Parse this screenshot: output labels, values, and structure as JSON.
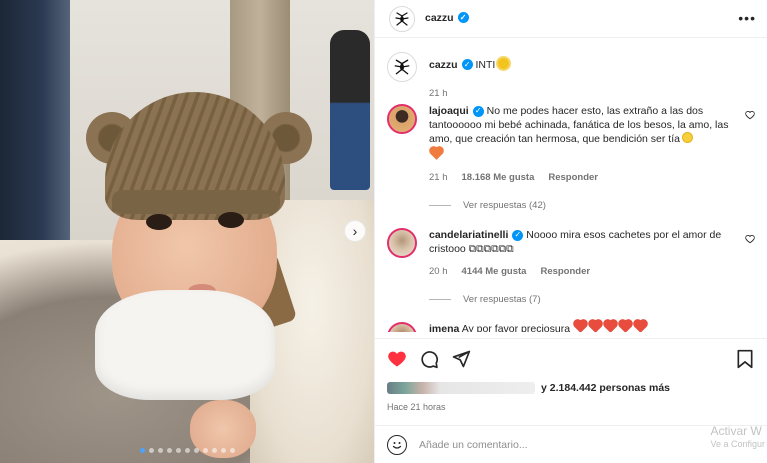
{
  "post": {
    "username": "cazzu",
    "verified_mark": "✓",
    "more_label": "•••",
    "caption_text": "INTI",
    "caption_time": "21 h",
    "carousel_next_label": "›",
    "carousel_dots": [
      true,
      false,
      false,
      false,
      false,
      false,
      false,
      false,
      false,
      false,
      false
    ]
  },
  "comments": [
    {
      "username": "lajoaqui",
      "text": "No me podes hacer esto, las extraño a las dos tantoooooo mi bebé achinada, fanática de los besos, la amo, las amo, que creación tan hermosa, que bendición ser tía",
      "time": "21 h",
      "likes": "18.168 Me gusta",
      "reply_label": "Responder",
      "view_replies": "Ver respuestas (42)"
    },
    {
      "username": "candelariatinelli",
      "text": "Noooo mira esos cachetes por el amor de cristooo ⧉⧉⧉⧉⧉⧉",
      "time": "20 h",
      "likes": "4144 Me gusta",
      "reply_label": "Responder",
      "view_replies": "Ver respuestas (7)"
    },
    {
      "username": "imena",
      "text": "Ay por favor preciosura"
    }
  ],
  "likes": {
    "text": "y 2.184.442 personas más"
  },
  "time_ago": "Hace 21 horas",
  "add_comment": {
    "placeholder": "Añade un comentario..."
  },
  "watermark": {
    "line1": "Activar W",
    "line2": "Ve a Configur"
  },
  "icons": {
    "like": "heart-filled-icon",
    "comment": "comment-icon",
    "share": "share-icon",
    "save": "bookmark-icon",
    "emoji": "emoji-icon"
  },
  "colors": {
    "verified": "#0095f6",
    "like_red": "#ff3040",
    "text": "#262626",
    "muted": "#737373"
  }
}
